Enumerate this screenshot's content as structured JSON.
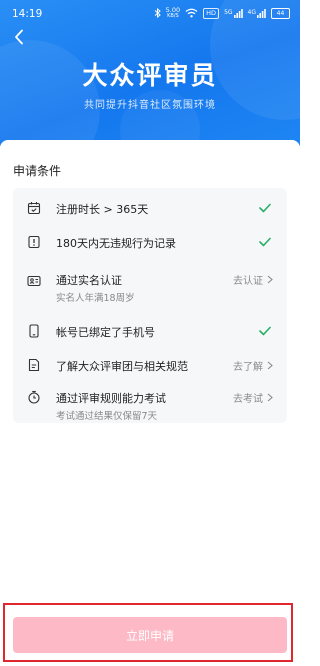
{
  "status_bar": {
    "time": "14:19",
    "net_speed_value": "5.00",
    "net_speed_unit": "KB/S",
    "hd_badge": "HD",
    "signal_5g": "5G",
    "signal_4g": "4G",
    "battery": "44"
  },
  "header": {
    "title": "大众评审员",
    "subtitle": "共同提升抖音社区氛围环境"
  },
  "section_title": "申请条件",
  "conditions": [
    {
      "label": "注册时长 > 365天",
      "sub": "",
      "icon": "calendar-icon",
      "state": "done"
    },
    {
      "label": "180天内无违规行为记录",
      "sub": "",
      "icon": "alert-doc-icon",
      "state": "done"
    },
    {
      "label": "通过实名认证",
      "sub": "实名人年满18周岁",
      "icon": "id-card-icon",
      "state": "action",
      "action": "去认证"
    },
    {
      "label": "帐号已绑定了手机号",
      "sub": "",
      "icon": "phone-icon",
      "state": "done"
    },
    {
      "label": "了解大众评审团与相关规范",
      "sub": "",
      "icon": "document-icon",
      "state": "action",
      "action": "去了解"
    },
    {
      "label": "通过评审规则能力考试",
      "sub": "考试通过结果仅保留7天",
      "icon": "stopwatch-icon",
      "state": "action",
      "action": "去考试"
    }
  ],
  "apply_button": "立即申请",
  "colors": {
    "banner": "#1477ee",
    "check": "#2aae67",
    "button_disabled": "#fdb9c5",
    "highlight_frame": "#e0272f"
  }
}
